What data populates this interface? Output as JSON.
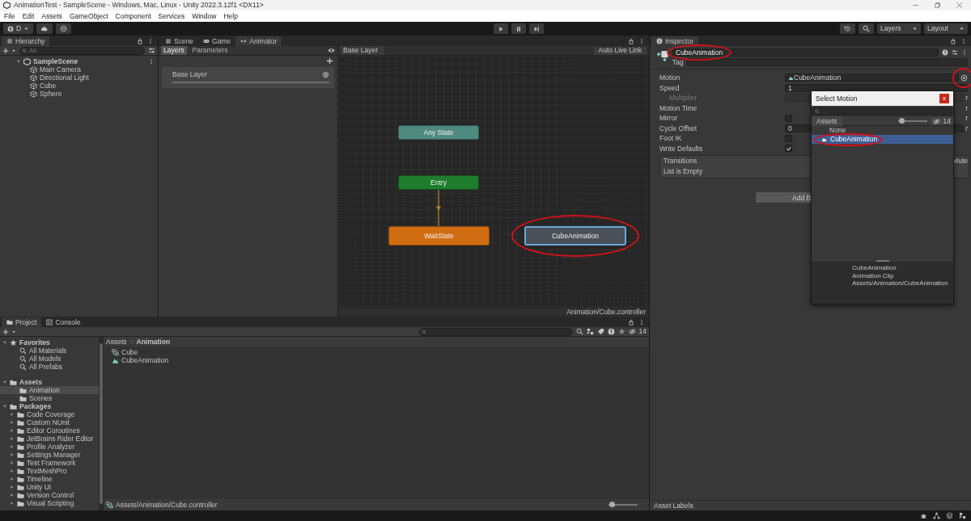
{
  "window": {
    "title": "AnimationTest - SampleScene - Windows, Mac, Linux - Unity 2022.3.12f1 <DX11>"
  },
  "menu": [
    "File",
    "Edit",
    "Assets",
    "GameObject",
    "Component",
    "Services",
    "Window",
    "Help"
  ],
  "toolbar": {
    "account": "D",
    "layers": "Layers",
    "layout": "Layout"
  },
  "hierarchy": {
    "tab": "Hierarchy",
    "placeholder": "All",
    "scene": {
      "label": "SampleScene",
      "expanded": true,
      "children": [
        {
          "label": "Main Camera"
        },
        {
          "label": "Directional Light"
        },
        {
          "label": "Cube"
        },
        {
          "label": "Sphere"
        }
      ]
    }
  },
  "animator": {
    "tabs": [
      {
        "label": "Scene",
        "kind": "scene",
        "selected": false
      },
      {
        "label": "Game",
        "kind": "game",
        "selected": false
      },
      {
        "label": "Animator",
        "kind": "animator",
        "selected": true
      }
    ],
    "subtabs": [
      {
        "label": "Layers",
        "selected": true
      },
      {
        "label": "Parameters",
        "selected": false
      }
    ],
    "layers": [
      "Base Layer"
    ],
    "breadcrumb": "Base Layer",
    "live_link": "Auto Live Link",
    "nodes": [
      {
        "label": "Any State",
        "color": "#4f8a80",
        "selected": false
      },
      {
        "label": "Entry",
        "color": "#1e7d2c",
        "selected": false,
        "transition_down": true
      },
      {
        "label": "WaitState",
        "color": "#d06d12",
        "selected": false
      },
      {
        "label": "CubeAnimation",
        "color": "#4a5058",
        "selected": true,
        "circled": true
      }
    ],
    "footer": "Animation/Cube.controller"
  },
  "project": {
    "tabs": [
      {
        "label": "Project",
        "kind": "project",
        "selected": true
      },
      {
        "label": "Console",
        "kind": "console",
        "selected": false
      }
    ],
    "tree": [
      {
        "label": "Favorites",
        "kind": "favorites",
        "expanded": true,
        "selected": false,
        "children": [
          {
            "label": "All Materials",
            "kind": "search",
            "selected": false
          },
          {
            "label": "All Models",
            "kind": "search",
            "selected": false
          },
          {
            "label": "All Prefabs",
            "kind": "search",
            "selected": false
          }
        ]
      },
      {
        "label": "Assets",
        "kind": "folder",
        "expanded": true,
        "selected": false,
        "children": [
          {
            "label": "Animation",
            "kind": "folder",
            "selected": true
          },
          {
            "label": "Scenes",
            "kind": "folder",
            "selected": false
          }
        ]
      },
      {
        "label": "Packages",
        "kind": "folder",
        "expanded": true,
        "selected": false,
        "children": [
          {
            "label": "Code Coverage",
            "kind": "folder",
            "expanded": false,
            "selected": false
          },
          {
            "label": "Custom NUnit",
            "kind": "folder",
            "expanded": false,
            "selected": false
          },
          {
            "label": "Editor Coroutines",
            "kind": "folder",
            "expanded": false,
            "selected": false
          },
          {
            "label": "JetBrains Rider Editor",
            "kind": "folder",
            "expanded": false,
            "selected": false
          },
          {
            "label": "Profile Analyzer",
            "kind": "folder",
            "expanded": false,
            "selected": false
          },
          {
            "label": "Settings Manager",
            "kind": "folder",
            "expanded": false,
            "selected": false
          },
          {
            "label": "Test Framework",
            "kind": "folder",
            "expanded": false,
            "selected": false
          },
          {
            "label": "TextMeshPro",
            "kind": "folder",
            "expanded": false,
            "selected": false
          },
          {
            "label": "Timeline",
            "kind": "folder",
            "expanded": false,
            "selected": false
          },
          {
            "label": "Unity UI",
            "kind": "folder",
            "expanded": false,
            "selected": false
          },
          {
            "label": "Version Control",
            "kind": "folder",
            "expanded": false,
            "selected": false
          },
          {
            "label": "Visual Scripting",
            "kind": "folder",
            "expanded": false,
            "selected": false
          }
        ]
      }
    ],
    "breadcrumb": [
      "Assets",
      "Animation"
    ],
    "files": [
      {
        "label": "Cube",
        "kind": "controller"
      },
      {
        "label": "CubeAnimation",
        "kind": "clip"
      }
    ],
    "hidden_count": "14",
    "footer": "Assets/Animation/Cube.controller",
    "level": 0.1
  },
  "inspector": {
    "tab": "Inspector",
    "name": {
      "value": "CubeAnimation",
      "circled": true
    },
    "tag_label": "Tag",
    "properties": [
      {
        "label": "Motion",
        "kind": "object",
        "value": "CubeAnimation",
        "circled": true,
        "disabled": false
      },
      {
        "label": "Speed",
        "kind": "field",
        "value": "1",
        "disabled": false,
        "children": [
          {
            "label": "Multiplier",
            "kind": "field",
            "disabled": true,
            "suffix": "r"
          }
        ]
      },
      {
        "label": "Motion Time",
        "kind": "none",
        "disabled": false,
        "suffix": "r"
      },
      {
        "label": "Mirror",
        "kind": "checkbox",
        "checked": false,
        "disabled": false,
        "suffix": "r"
      },
      {
        "label": "Cycle Offset",
        "kind": "field",
        "value": "0",
        "disabled": false,
        "suffix": "r"
      },
      {
        "label": "Foot IK",
        "kind": "checkbox",
        "checked": false,
        "disabled": false
      },
      {
        "label": "Write Defaults",
        "kind": "checkbox",
        "checked": true,
        "disabled": false
      }
    ],
    "transitions": {
      "header": "Transitions",
      "mute": "Mute",
      "empty": "List is Empty"
    },
    "add_button": "Add B",
    "asset_labels": "Asset Labels"
  },
  "picker": {
    "title": "Select Motion",
    "close": "x",
    "tab": "Assets",
    "level": 0.12,
    "hidden_count": "14",
    "items": [
      {
        "label": "None",
        "selected": false
      },
      {
        "label": "CubeAnimation",
        "selected": true,
        "circled": true
      }
    ],
    "preview": [
      "CubeAnimation",
      "Animation Clip",
      "Assets/Animation/CubeAnimation"
    ]
  }
}
